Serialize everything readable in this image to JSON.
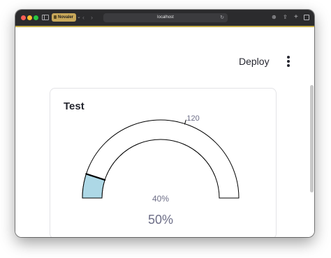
{
  "browser": {
    "tab_label": "Novaler",
    "url": "localhost",
    "icons": [
      "sidebar-icon",
      "back-arrow-icon",
      "forward-arrow-icon",
      "reload-icon",
      "download-icon",
      "share-icon",
      "new-tab-icon",
      "tab-overview-icon"
    ]
  },
  "app": {
    "deploy_label": "Deploy",
    "menu_icon": "kebab-menu-icon"
  },
  "card": {
    "title": "Test"
  },
  "gauge": {
    "min": 0,
    "max": 200,
    "value": 20,
    "threshold_value": 120,
    "threshold_label": "120",
    "marker_value": 20,
    "center_label": "40%",
    "value_label": "50%",
    "fill_color": "#add8e6",
    "stroke_color": "#000000",
    "label_color": "#6d6e87"
  }
}
